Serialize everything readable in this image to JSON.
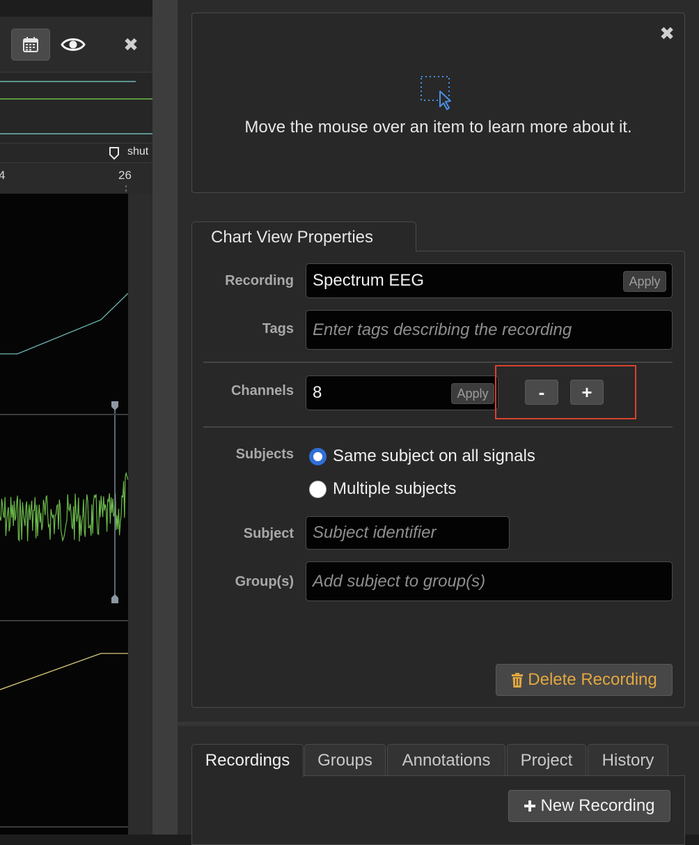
{
  "chart": {
    "tick_left": "4",
    "tick_right": "26",
    "marker_label": "shut"
  },
  "help": {
    "text": "Move the mouse over an item to learn more about it."
  },
  "properties": {
    "tab_title": "Chart View Properties",
    "recording": {
      "label": "Recording",
      "value": "Spectrum EEG",
      "apply": "Apply"
    },
    "tags": {
      "label": "Tags",
      "placeholder": "Enter tags describing the recording"
    },
    "channels": {
      "label": "Channels",
      "value": "8",
      "apply": "Apply",
      "minus": "-",
      "plus": "+"
    },
    "subjects": {
      "label": "Subjects",
      "option_same": "Same subject on all signals",
      "option_multiple": "Multiple subjects",
      "selected": "Same subject on all signals"
    },
    "subject": {
      "label": "Subject",
      "placeholder": "Subject identifier"
    },
    "groups": {
      "label": "Group(s)",
      "placeholder": "Add subject to group(s)"
    },
    "delete_label": "Delete Recording"
  },
  "bottom": {
    "tabs": [
      "Recordings",
      "Groups",
      "Annotations",
      "Project",
      "History"
    ],
    "active_tab": "Recordings",
    "new_recording_label": "New Recording"
  },
  "colors": {
    "accent_blue": "#2f6fd6",
    "highlight_red": "#d9432f",
    "delete_orange": "#e3a740",
    "trace_teal": "#6fb8b4",
    "trace_green": "#6dbb4c",
    "trace_yellow": "#d8cc7a"
  },
  "icons": {
    "calendar": "calendar-icon",
    "eye": "eye-icon",
    "close": "close-icon",
    "help": "select-cursor-icon",
    "trash": "trash-icon",
    "plus": "plus-icon"
  }
}
